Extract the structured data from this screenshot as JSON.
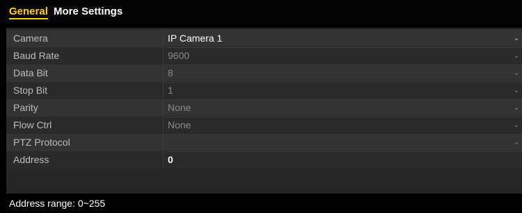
{
  "tabs": [
    {
      "label": "General",
      "active": true
    },
    {
      "label": "More Settings",
      "active": false
    }
  ],
  "rows": [
    {
      "label": "Camera",
      "value": "IP Camera 1",
      "type": "dropdown",
      "enabled": true
    },
    {
      "label": "Baud Rate",
      "value": "9600",
      "type": "dropdown",
      "enabled": false
    },
    {
      "label": "Data Bit",
      "value": "8",
      "type": "dropdown",
      "enabled": false
    },
    {
      "label": "Stop Bit",
      "value": "1",
      "type": "dropdown",
      "enabled": false
    },
    {
      "label": "Parity",
      "value": "None",
      "type": "dropdown",
      "enabled": false
    },
    {
      "label": "Flow Ctrl",
      "value": "None",
      "type": "dropdown",
      "enabled": false
    },
    {
      "label": "PTZ Protocol",
      "value": "",
      "type": "dropdown",
      "enabled": false
    },
    {
      "label": "Address",
      "value": "0",
      "type": "text",
      "enabled": true
    }
  ],
  "hint": "Address range: 0~255",
  "colors": {
    "background": "#000000",
    "active_tab": "#ffd200",
    "panel": "#262626",
    "row_light": "#333333",
    "row_dark": "#2a2a2a",
    "label_text": "#bdbdbd",
    "disabled_text": "#8a8a8a",
    "enabled_text": "#ffffff"
  },
  "icons": {
    "dropdown": "chevron-down-icon"
  }
}
